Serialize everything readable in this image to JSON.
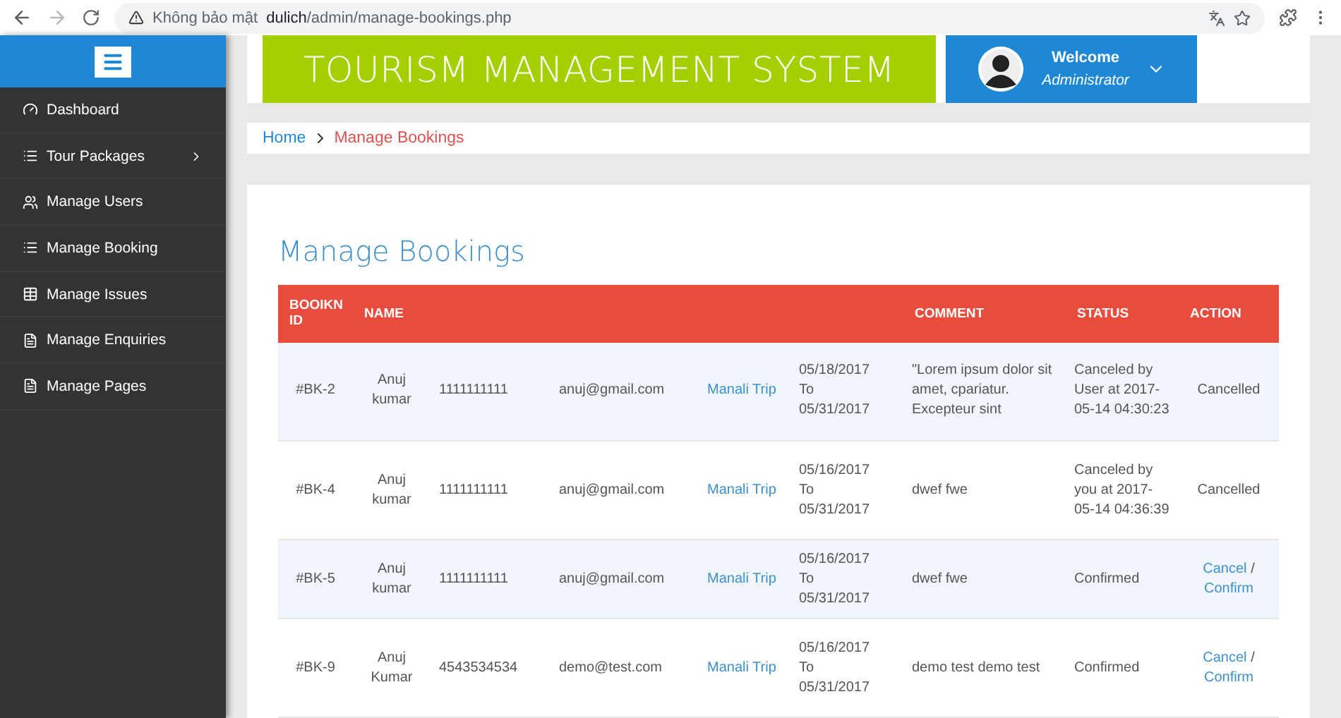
{
  "browser": {
    "security": "Không bảo mật",
    "url_host": "dulich",
    "url_path": "/admin/manage-bookings.php"
  },
  "sidebar": {
    "items": [
      {
        "label": "Dashboard",
        "has_submenu": false
      },
      {
        "label": "Tour Packages",
        "has_submenu": true
      },
      {
        "label": "Manage Users",
        "has_submenu": false
      },
      {
        "label": "Manage Booking",
        "has_submenu": false
      },
      {
        "label": "Manage Issues",
        "has_submenu": false
      },
      {
        "label": "Manage Enquiries",
        "has_submenu": false
      },
      {
        "label": "Manage Pages",
        "has_submenu": false
      }
    ]
  },
  "header": {
    "title": "TOURISM MANAGEMENT SYSTEM",
    "welcome": "Welcome",
    "role": "Administrator"
  },
  "breadcrumb": {
    "home": "Home",
    "current": "Manage Bookings"
  },
  "page_title": "Manage Bookings",
  "table": {
    "columns": [
      "BOOIKN ID",
      "NAME",
      null,
      null,
      null,
      null,
      "COMMENT",
      "STATUS",
      "ACTION"
    ],
    "rows": [
      {
        "id": "#BK-2",
        "name": "Anuj kumar",
        "phone": "1111111111",
        "email": "anuj@gmail.com",
        "package": "Manali Trip",
        "from": "05/18/2017",
        "to_word": "To",
        "to": "05/31/2017",
        "comment": "\"Lorem ipsum dolor sit amet, cpariatur. Excepteur sint",
        "status": "Canceled by User at 2017-05-14 04:30:23",
        "action": {
          "kind": "text",
          "text": "Cancelled"
        }
      },
      {
        "id": "#BK-4",
        "name": "Anuj kumar",
        "phone": "1111111111",
        "email": "anuj@gmail.com",
        "package": "Manali Trip",
        "from": "05/16/2017",
        "to_word": "To",
        "to": "05/31/2017",
        "comment": "dwef fwe",
        "status": "Canceled by you at 2017-05-14 04:36:39",
        "action": {
          "kind": "text",
          "text": "Cancelled"
        }
      },
      {
        "id": "#BK-5",
        "name": "Anuj kumar",
        "phone": "1111111111",
        "email": "anuj@gmail.com",
        "package": "Manali Trip",
        "from": "05/16/2017",
        "to_word": "To",
        "to": "05/31/2017",
        "comment": "dwef fwe",
        "status": "Confirmed",
        "action": {
          "kind": "links",
          "cancel": "Cancel",
          "separator": "/",
          "confirm": "Confirm"
        }
      },
      {
        "id": "#BK-9",
        "name": "Anuj Kumar",
        "phone": "4543534534",
        "email": "demo@test.com",
        "package": "Manali Trip",
        "from": "05/16/2017",
        "to_word": "To",
        "to": "05/31/2017",
        "comment": "demo test demo test",
        "status": "Confirmed",
        "action": {
          "kind": "links",
          "cancel": "Cancel",
          "separator": "/",
          "confirm": "Confirm"
        }
      }
    ]
  }
}
